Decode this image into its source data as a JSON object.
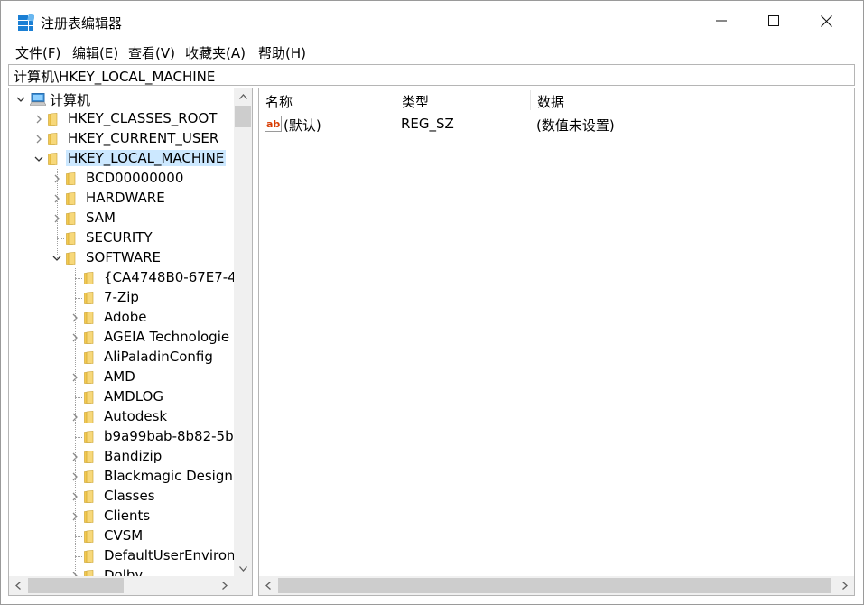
{
  "window": {
    "title": "注册表编辑器",
    "controls": {
      "minimize": "minimize",
      "maximize": "maximize",
      "close": "close"
    }
  },
  "menu": [
    {
      "label": "文件(F)"
    },
    {
      "label": "编辑(E)"
    },
    {
      "label": "查看(V)"
    },
    {
      "label": "收藏夹(A)"
    },
    {
      "label": "帮助(H)"
    }
  ],
  "address": {
    "path": "计算机\\HKEY_LOCAL_MACHINE"
  },
  "tree": {
    "items": [
      {
        "label": "计算机",
        "level": 0,
        "expander": "expanded",
        "icon": "computer-icon"
      },
      {
        "label": "HKEY_CLASSES_ROOT",
        "level": 1,
        "expander": "collapsed",
        "icon": "folder-icon"
      },
      {
        "label": "HKEY_CURRENT_USER",
        "level": 1,
        "expander": "collapsed",
        "icon": "folder-icon"
      },
      {
        "label": "HKEY_LOCAL_MACHINE",
        "level": 1,
        "expander": "expanded",
        "icon": "folder-icon",
        "selected": true
      },
      {
        "label": "BCD00000000",
        "level": 2,
        "expander": "collapsed",
        "icon": "folder-icon"
      },
      {
        "label": "HARDWARE",
        "level": 2,
        "expander": "collapsed",
        "icon": "folder-icon"
      },
      {
        "label": "SAM",
        "level": 2,
        "expander": "collapsed",
        "icon": "folder-icon"
      },
      {
        "label": "SECURITY",
        "level": 2,
        "expander": "none",
        "icon": "folder-icon"
      },
      {
        "label": "SOFTWARE",
        "level": 2,
        "expander": "expanded",
        "icon": "folder-icon"
      },
      {
        "label": "{CA4748B0-67E7-4",
        "level": 3,
        "expander": "none",
        "icon": "folder-icon"
      },
      {
        "label": "7-Zip",
        "level": 3,
        "expander": "none",
        "icon": "folder-icon"
      },
      {
        "label": "Adobe",
        "level": 3,
        "expander": "collapsed",
        "icon": "folder-icon"
      },
      {
        "label": "AGEIA Technologie",
        "level": 3,
        "expander": "collapsed",
        "icon": "folder-icon"
      },
      {
        "label": "AliPaladinConfig",
        "level": 3,
        "expander": "none",
        "icon": "folder-icon"
      },
      {
        "label": "AMD",
        "level": 3,
        "expander": "collapsed",
        "icon": "folder-icon"
      },
      {
        "label": "AMDLOG",
        "level": 3,
        "expander": "none",
        "icon": "folder-icon"
      },
      {
        "label": "Autodesk",
        "level": 3,
        "expander": "collapsed",
        "icon": "folder-icon"
      },
      {
        "label": "b9a99bab-8b82-5b",
        "level": 3,
        "expander": "none",
        "icon": "folder-icon"
      },
      {
        "label": "Bandizip",
        "level": 3,
        "expander": "collapsed",
        "icon": "folder-icon"
      },
      {
        "label": "Blackmagic Design",
        "level": 3,
        "expander": "collapsed",
        "icon": "folder-icon"
      },
      {
        "label": "Classes",
        "level": 3,
        "expander": "collapsed",
        "icon": "folder-icon"
      },
      {
        "label": "Clients",
        "level": 3,
        "expander": "collapsed",
        "icon": "folder-icon"
      },
      {
        "label": "CVSM",
        "level": 3,
        "expander": "none",
        "icon": "folder-icon"
      },
      {
        "label": "DefaultUserEnviron",
        "level": 3,
        "expander": "none",
        "icon": "folder-icon"
      },
      {
        "label": "Dolby",
        "level": 3,
        "expander": "collapsed",
        "icon": "folder-icon"
      }
    ]
  },
  "list": {
    "columns": [
      {
        "label": "名称"
      },
      {
        "label": "类型"
      },
      {
        "label": "数据"
      }
    ],
    "rows": [
      {
        "name": "(默认)",
        "type": "REG_SZ",
        "data": "(数值未设置)",
        "icon": "string-value-icon"
      }
    ]
  },
  "colors": {
    "selection": "#cce8ff",
    "folder": "#f3c94f",
    "scrollbar_track": "#f0f0f0",
    "scrollbar_thumb": "#cdcdcd"
  }
}
